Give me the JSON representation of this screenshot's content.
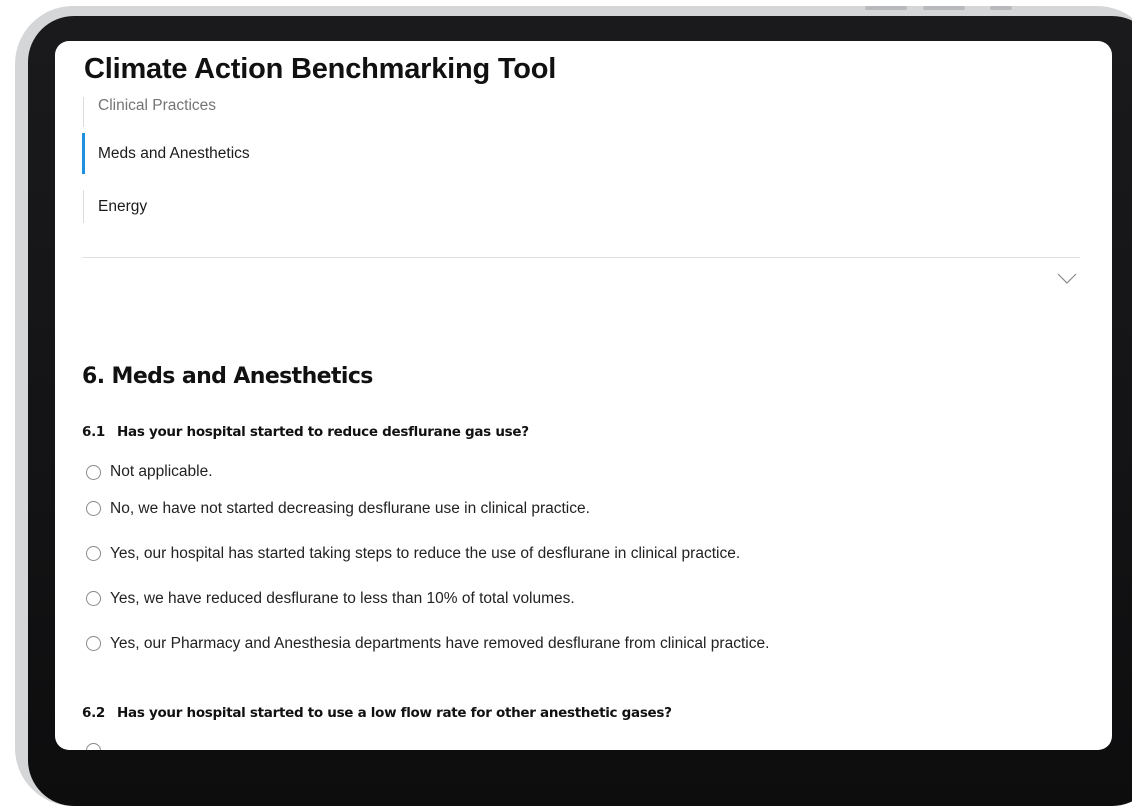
{
  "app": {
    "title": "Climate Action Benchmarking Tool"
  },
  "subnav": {
    "items": [
      {
        "label": "Clinical Practices",
        "active": false
      },
      {
        "label": "Meds and Anesthetics",
        "active": true
      },
      {
        "label": "Energy",
        "active": false
      }
    ],
    "expand_icon": "chevron-down-icon"
  },
  "section": {
    "title": "6. Meds and Anesthetics"
  },
  "questions": [
    {
      "number": "6.1",
      "text": "Has your hospital started to reduce desflurane gas use?",
      "options": [
        "Not applicable.",
        "No, we have not started decreasing desflurane use in clinical practice.",
        "Yes, our hospital has started taking steps to reduce the use of desflurane in clinical practice.",
        "Yes, we have reduced desflurane to less than 10% of total volumes.",
        "Yes, our Pharmacy and Anesthesia departments have removed desflurane from clinical practice."
      ],
      "selected": null
    },
    {
      "number": "6.2",
      "text": "Has your hospital started to use a low flow rate for other anesthetic gases?"
    }
  ],
  "colors": {
    "accent": "#1f8fe0",
    "text": "#111111",
    "muted": "#757575",
    "frame": "#141416"
  }
}
